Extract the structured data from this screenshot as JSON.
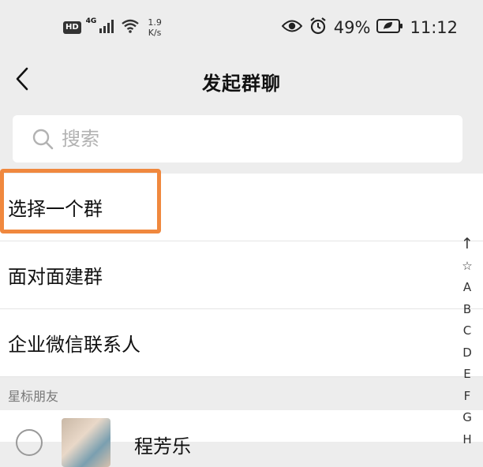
{
  "status_bar": {
    "hd_label": "HD",
    "net_label": "4G",
    "speed_value": "1.9",
    "speed_unit": "K/s",
    "battery": "49%",
    "time": "11:12"
  },
  "nav": {
    "title": "发起群聊"
  },
  "search": {
    "placeholder": "搜索"
  },
  "options": [
    {
      "label": "选择一个群"
    },
    {
      "label": "面对面建群"
    },
    {
      "label": "企业微信联系人"
    }
  ],
  "section": {
    "starred_header": "星标朋友"
  },
  "contacts": [
    {
      "name": "程芳乐"
    }
  ],
  "index_bar": [
    "↑",
    "☆",
    "A",
    "B",
    "C",
    "D",
    "E",
    "F",
    "G",
    "H"
  ],
  "colors": {
    "highlight": "#f0883e",
    "background": "#ededed"
  },
  "icons": {
    "back": "chevron-left-icon",
    "search": "search-icon"
  }
}
